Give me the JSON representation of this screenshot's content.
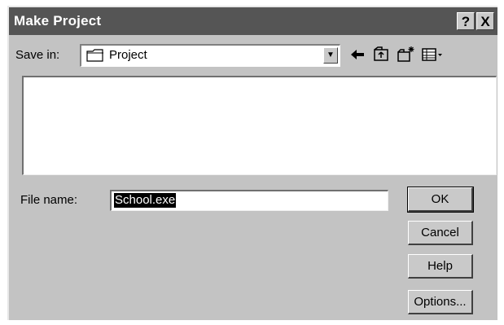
{
  "dialog": {
    "title": "Make Project",
    "help_button": "?",
    "close_button": "X"
  },
  "toolbar": {
    "save_in_label": "Save in:",
    "save_in_value": "Project",
    "icons": [
      "back-arrow-icon",
      "up-folder-icon",
      "new-folder-icon",
      "view-menu-icon"
    ]
  },
  "file": {
    "name_label": "File name:",
    "name_value": "School.exe"
  },
  "buttons": {
    "ok": "OK",
    "cancel": "Cancel",
    "help": "Help",
    "options": "Options..."
  }
}
